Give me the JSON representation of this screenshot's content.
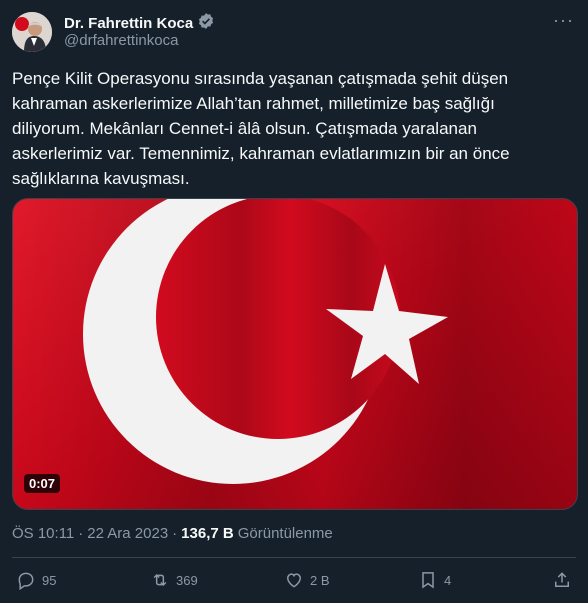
{
  "author": {
    "display_name": "Dr. Fahrettin Koca",
    "handle": "@drfahrettinkoca",
    "verified": true
  },
  "tweet": {
    "text": "Pençe Kilit Operasyonu sırasında yaşanan çatışmada şehit düşen kahraman askerlerimize Allah’tan rahmet, milletimize baş sağlığı diliyorum. Mekânları Cennet-i âlâ olsun. Çatışmada yaralanan askerlerimiz var. Temennimiz, kahraman evlatlarımızın bir an önce sağlıklarına kavuşması."
  },
  "media": {
    "type": "video",
    "duration": "0:07",
    "flag_red": "#d20a1e",
    "flag_white": "#f2f2f2"
  },
  "meta": {
    "time": "ÖS 10:11",
    "separator": "·",
    "date": "22 Ara 2023",
    "views_count": "136,7 B",
    "views_label": "Görüntülenme"
  },
  "actions": {
    "replies": "95",
    "reposts": "369",
    "likes": "2 B",
    "bookmarks": "4"
  },
  "colors": {
    "background": "#15202b",
    "text": "#f7f9f9",
    "secondary": "#8b98a5",
    "verified": "#8b98a5"
  }
}
